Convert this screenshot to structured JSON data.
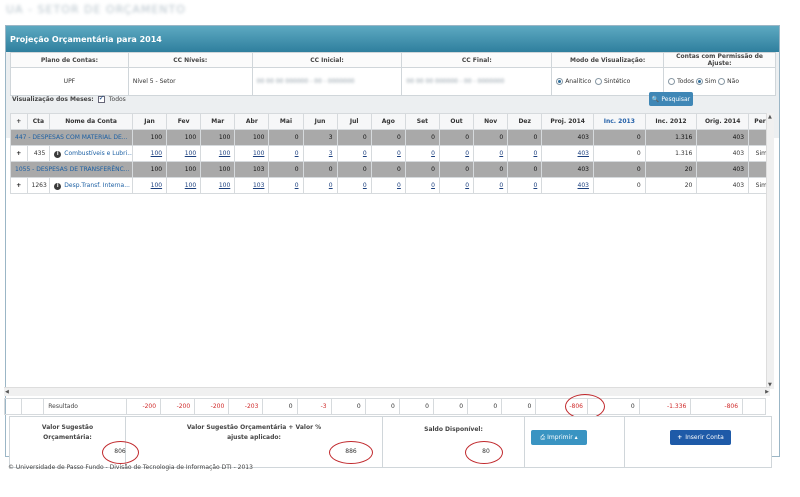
{
  "header": {
    "blurred_title": "UA - SETOR DE ORÇAMENTO"
  },
  "panel": {
    "title": "Projeção Orçamentária para 2014"
  },
  "filters": {
    "headers": [
      "Plano de Contas:",
      "CC Níveis:",
      "CC Inicial:",
      "CC Final:",
      "Modo de Visualização:",
      "Contas com Permissão de Ajuste:"
    ],
    "plano": "UPF",
    "nivel": "Nível 5 - Setor",
    "cc_inicial": "00 00 00 000000 - 00 - 0000000",
    "cc_final": "00 00 00 000000 - 00 - 0000000",
    "modo_options": [
      "Analítico",
      "Sintético"
    ],
    "permissao_options": [
      "Todos",
      "Sim",
      "Não"
    ],
    "meses_label": "Visualização dos Meses:",
    "meses_all": "Todos",
    "search_label": "Pesquisar"
  },
  "grid": {
    "columns": [
      "Cta",
      "Nome da Conta",
      "Jan",
      "Fev",
      "Mar",
      "Abr",
      "Mai",
      "Jun",
      "Jul",
      "Ago",
      "Set",
      "Out",
      "Nov",
      "Dez",
      "Proj. 2014",
      "Inc. 2013",
      "Inc. 2012",
      "Orig. 2014",
      "Per"
    ],
    "rows": [
      {
        "type": "grp",
        "name": "447 - DESPESAS COM MATERIAL DE...",
        "vals": [
          "100",
          "100",
          "100",
          "100",
          "0",
          "3",
          "0",
          "0",
          "0",
          "0",
          "0",
          "0",
          "403",
          "0",
          "1.316",
          "403",
          ""
        ]
      },
      {
        "type": "item",
        "cta": "435",
        "name": "Combustíveis e Lubri...",
        "vals": [
          "100",
          "100",
          "100",
          "100",
          "0",
          "3",
          "0",
          "0",
          "0",
          "0",
          "0",
          "0",
          "403",
          "0",
          "1.316",
          "403",
          "Sim"
        ]
      },
      {
        "type": "grp",
        "name": "1055 - DESPESAS DE TRANSFERÊNC...",
        "vals": [
          "100",
          "100",
          "100",
          "103",
          "0",
          "0",
          "0",
          "0",
          "0",
          "0",
          "0",
          "0",
          "403",
          "0",
          "20",
          "403",
          ""
        ]
      },
      {
        "type": "item",
        "cta": "1263",
        "name": "Desp.Transf. Interna...",
        "vals": [
          "100",
          "100",
          "100",
          "103",
          "0",
          "0",
          "0",
          "0",
          "0",
          "0",
          "0",
          "0",
          "403",
          "0",
          "20",
          "403",
          "Sim"
        ]
      }
    ]
  },
  "resultado": {
    "label": "Resultado",
    "vals": [
      "-200",
      "-200",
      "-200",
      "-203",
      "0",
      "-3",
      "0",
      "0",
      "0",
      "0",
      "0",
      "0",
      "-806",
      "0",
      "-1.336",
      "-806",
      ""
    ]
  },
  "summary": {
    "sugestao_label": "Valor Sugestão Orçamentária:",
    "sugestao_value": "806",
    "ajuste_label": "Valor Sugestão Orçamentária + Valor % ajuste aplicado:",
    "ajuste_value": "886",
    "saldo_label": "Saldo Disponível:",
    "saldo_value": "80",
    "print_label": "Imprimir",
    "insert_label": "Inserir Conta"
  },
  "copyright": "© Universidade de Passo Fundo - Divisão de Tecnologia de Informação DTI - 2013"
}
